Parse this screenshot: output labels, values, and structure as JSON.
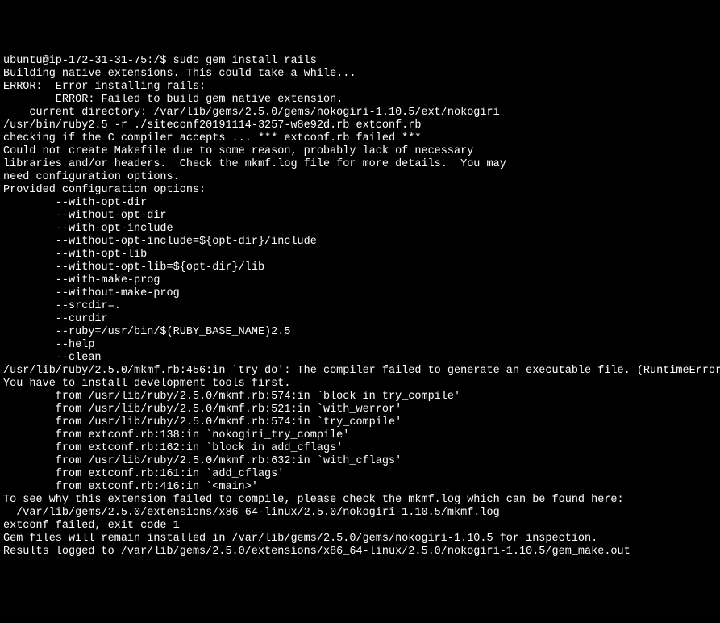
{
  "terminal": {
    "prompt": "ubuntu@ip-172-31-31-75:/$ ",
    "command": "sudo gem install rails",
    "lines": [
      "Building native extensions. This could take a while...",
      "ERROR:  Error installing rails:",
      "        ERROR: Failed to build gem native extension.",
      "",
      "    current directory: /var/lib/gems/2.5.0/gems/nokogiri-1.10.5/ext/nokogiri",
      "/usr/bin/ruby2.5 -r ./siteconf20191114-3257-w8e92d.rb extconf.rb",
      "checking if the C compiler accepts ... *** extconf.rb failed ***",
      "Could not create Makefile due to some reason, probably lack of necessary",
      "libraries and/or headers.  Check the mkmf.log file for more details.  You may",
      "need configuration options.",
      "",
      "Provided configuration options:",
      "        --with-opt-dir",
      "        --without-opt-dir",
      "        --with-opt-include",
      "        --without-opt-include=${opt-dir}/include",
      "        --with-opt-lib",
      "        --without-opt-lib=${opt-dir}/lib",
      "        --with-make-prog",
      "        --without-make-prog",
      "        --srcdir=.",
      "        --curdir",
      "        --ruby=/usr/bin/$(RUBY_BASE_NAME)2.5",
      "        --help",
      "        --clean",
      "/usr/lib/ruby/2.5.0/mkmf.rb:456:in `try_do': The compiler failed to generate an executable file. (RuntimeError)",
      "You have to install development tools first.",
      "        from /usr/lib/ruby/2.5.0/mkmf.rb:574:in `block in try_compile'",
      "        from /usr/lib/ruby/2.5.0/mkmf.rb:521:in `with_werror'",
      "        from /usr/lib/ruby/2.5.0/mkmf.rb:574:in `try_compile'",
      "        from extconf.rb:138:in `nokogiri_try_compile'",
      "        from extconf.rb:162:in `block in add_cflags'",
      "        from /usr/lib/ruby/2.5.0/mkmf.rb:632:in `with_cflags'",
      "        from extconf.rb:161:in `add_cflags'",
      "        from extconf.rb:416:in `<main>'",
      "",
      "To see why this extension failed to compile, please check the mkmf.log which can be found here:",
      "",
      "  /var/lib/gems/2.5.0/extensions/x86_64-linux/2.5.0/nokogiri-1.10.5/mkmf.log",
      "",
      "extconf failed, exit code 1",
      "",
      "Gem files will remain installed in /var/lib/gems/2.5.0/gems/nokogiri-1.10.5 for inspection.",
      "Results logged to /var/lib/gems/2.5.0/extensions/x86_64-linux/2.5.0/nokogiri-1.10.5/gem_make.out"
    ]
  }
}
